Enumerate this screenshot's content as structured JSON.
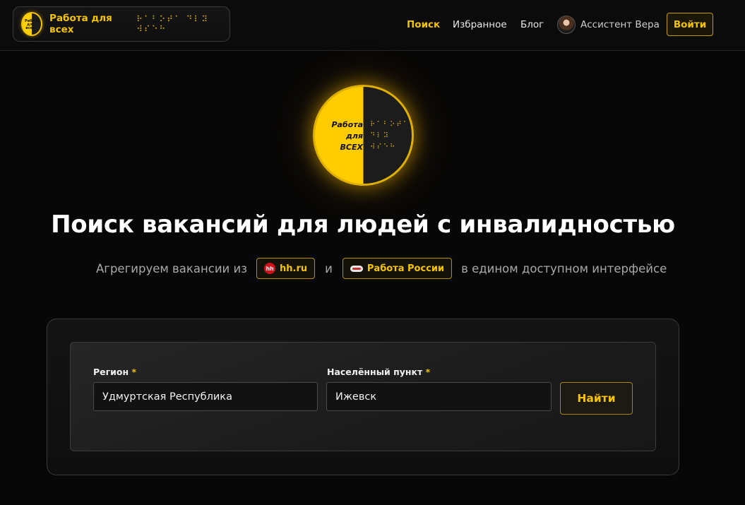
{
  "brand": {
    "title": "Работа для всех",
    "braille": "⠗⠁⠃⠕⠞⠁ ⠙⠇⠽ ⠺⠎⠑⠓",
    "logo_mini": "Работа для всех"
  },
  "nav": {
    "search": "Поиск",
    "favorites": "Избранное",
    "blog": "Блог",
    "assistant": "Ассистент Вера",
    "login": "Войти"
  },
  "hero": {
    "logo_text_line1": "Работа",
    "logo_text_line2": "для",
    "logo_text_line3": "ВСЕХ",
    "logo_braille_line1": "⠗⠁⠃⠕⠞⠁",
    "logo_braille_line2": "⠙⠇⠽",
    "logo_braille_line3": "⠺⠎⠑⠓",
    "title": "Поиск вакансий для людей с инвалидностью",
    "sub_prefix": "Агрегируем вакансии из",
    "source1": "hh.ru",
    "source1_icon": "hh",
    "connector": "и",
    "source2": "Работа России",
    "sub_suffix": "в едином доступном интерфейсе"
  },
  "form": {
    "region_label": "Регион",
    "region_value": "Удмуртская Республика",
    "city_label": "Населённый пункт",
    "city_value": "Ижевск",
    "required_mark": "*",
    "submit": "Найти"
  },
  "colors": {
    "accent": "#f5c400",
    "background": "#070707"
  }
}
